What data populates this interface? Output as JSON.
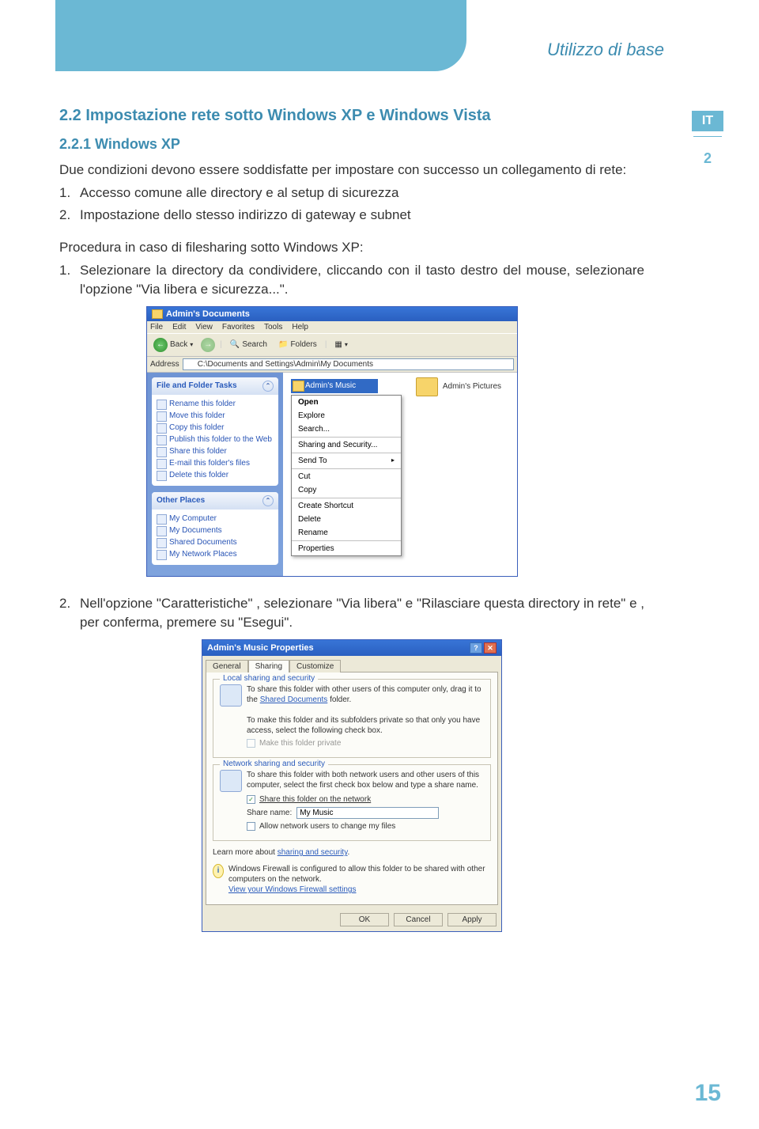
{
  "section_label": "Utilizzo di base",
  "side_lang": "IT",
  "side_num": "2",
  "h2": "2.2 Impostazione rete sotto Windows XP e Windows Vista",
  "h3": "2.2.1 Windows XP",
  "intro": "Due condizioni devono essere soddisfatte per impostare con successo un collegamento di rete:",
  "cond1": "Accesso comune alle directory e al setup di sicurezza",
  "cond2": "Impostazione dello stesso indirizzo di gateway e subnet",
  "proc_head": "Procedura in caso di filesharing sotto Windows XP:",
  "step1": "Selezionare la directory da condividere, cliccando con il tasto destro del mouse, selezionare l'opzione \"Via libera e sicurezza...\".",
  "step2": "Nell'opzione \"Caratteristiche\" , selezionare \"Via libera\" e \"Rilasciare  questa directory in rete\" e , per conferma, premere su \"Esegui\".",
  "explorer": {
    "title": "Admin's Documents",
    "menus": [
      "File",
      "Edit",
      "View",
      "Favorites",
      "Tools",
      "Help"
    ],
    "toolbar": {
      "back": "Back",
      "search": "Search",
      "folders": "Folders"
    },
    "address_label": "Address",
    "address_path": "C:\\Documents and Settings\\Admin\\My Documents",
    "panel1_title": "File and Folder Tasks",
    "panel1_items": [
      "Rename this folder",
      "Move this folder",
      "Copy this folder",
      "Publish this folder to the Web",
      "Share this folder",
      "E-mail this folder's files",
      "Delete this folder"
    ],
    "panel2_title": "Other Places",
    "panel2_items": [
      "My Computer",
      "My Documents",
      "Shared Documents",
      "My Network Places"
    ],
    "selected_folder": "Admin's Music",
    "right_folder": "Admin's Pictures",
    "context": [
      "Open",
      "Explore",
      "Search...",
      "—",
      "Sharing and Security...",
      "—",
      "Send To",
      "—",
      "Cut",
      "Copy",
      "—",
      "Create Shortcut",
      "Delete",
      "Rename",
      "—",
      "Properties"
    ]
  },
  "props": {
    "title": "Admin's Music Properties",
    "tabs": [
      "General",
      "Sharing",
      "Customize"
    ],
    "fs1_legend": "Local sharing and security",
    "fs1_txt1": "To share this folder with other users of this computer only, drag it to the ",
    "fs1_link": "Shared Documents",
    "fs1_txt1b": " folder.",
    "fs1_txt2": "To make this folder and its subfolders private so that only you have access, select the following check box.",
    "fs1_chk": "Make this folder private",
    "fs2_legend": "Network sharing and security",
    "fs2_txt1": "To share this folder with both network users and other users of this computer, select the first check box below and type a share name.",
    "fs2_chk1": "Share this folder on the network",
    "fs2_name_lbl": "Share name:",
    "fs2_name_val": "My Music",
    "fs2_chk2": "Allow network users to change my files",
    "learn": "Learn more about ",
    "learn_link": "sharing and security",
    "info_txt": "Windows Firewall is configured to allow this folder to be shared with other computers on the network.",
    "info_link": "View your Windows Firewall settings",
    "ok": "OK",
    "cancel": "Cancel",
    "apply": "Apply"
  },
  "page_num": "15"
}
